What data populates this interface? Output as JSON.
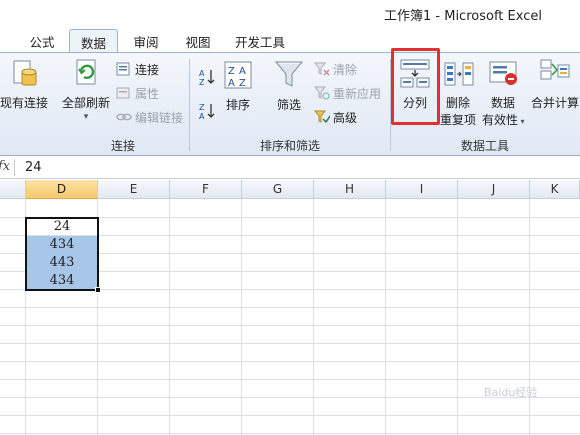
{
  "window": {
    "title": "工作簿1 - Microsoft Excel"
  },
  "tabs": [
    {
      "label": "公式",
      "active": false
    },
    {
      "label": "数据",
      "active": true
    },
    {
      "label": "审阅",
      "active": false
    },
    {
      "label": "视图",
      "active": false
    },
    {
      "label": "开发工具",
      "active": false
    }
  ],
  "ribbon": {
    "groups": {
      "connections": {
        "label": "连接",
        "existing_connections": "现有连接",
        "refresh_all": "全部刷新",
        "connections": "连接",
        "properties": "属性",
        "edit_links": "编辑链接"
      },
      "sort_filter": {
        "label": "排序和筛选",
        "sort": "排序",
        "filter": "筛选",
        "clear": "清除",
        "reapply": "重新应用",
        "advanced": "高级"
      },
      "data_tools": {
        "label": "数据工具",
        "text_to_columns": "分列",
        "remove_duplicates_line1": "删除",
        "remove_duplicates_line2": "重复项",
        "data_validation_line1": "数据",
        "data_validation_line2": "有效性",
        "consolidate": "合并计算"
      }
    }
  },
  "formula_bar": {
    "fx": "fx",
    "value": "24"
  },
  "sheet": {
    "columns": [
      "D",
      "E",
      "F",
      "G",
      "H",
      "I",
      "J",
      "K"
    ],
    "selected_column": "D",
    "cells": [
      "24",
      "434",
      "443",
      "434"
    ]
  },
  "watermark": "Baidu经验"
}
